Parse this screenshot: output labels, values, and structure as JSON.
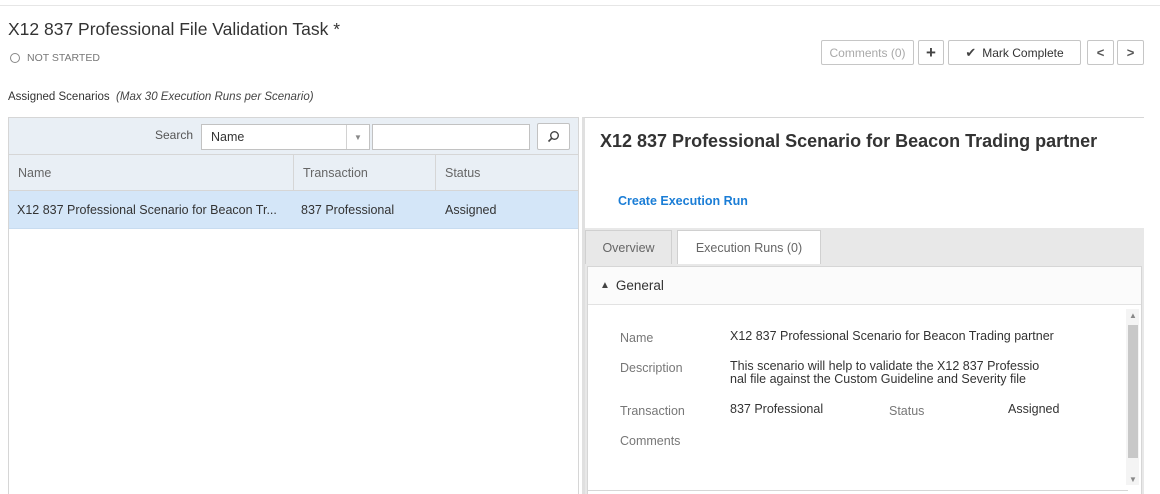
{
  "task": {
    "title": "X12 837 Professional File Validation Task *",
    "status": "NOT STARTED"
  },
  "toolbar": {
    "comments_label": "Comments (0)",
    "add_label": "+",
    "complete_label": "Mark Complete",
    "prev_label": "<",
    "next_label": ">"
  },
  "scenarios_label": {
    "text": "Assigned Scenarios",
    "note": "(Max 30 Execution Runs per Scenario)"
  },
  "search": {
    "label": "Search",
    "field_value": "Name",
    "input_value": ""
  },
  "table": {
    "columns": [
      "Name",
      "Transaction",
      "Status"
    ],
    "rows": [
      {
        "name": "X12 837 Professional Scenario for Beacon Tr...",
        "transaction": "837 Professional",
        "status": "Assigned"
      }
    ]
  },
  "detail": {
    "title": "X12 837 Professional Scenario for Beacon Trading partner",
    "create_link": "Create Execution Run",
    "tabs": [
      "Overview",
      "Execution Runs (0)"
    ],
    "active_tab": "Overview",
    "section_title": "General",
    "fields": {
      "name_label": "Name",
      "name_value": "X12 837 Professional Scenario for Beacon Trading partner",
      "description_label": "Description",
      "description_line1": "This scenario will help to validate the X12 837 Professio",
      "description_line2": "nal file against the Custom Guideline and Severity file",
      "transaction_label": "Transaction",
      "transaction_value": "837 Professional",
      "status_label": "Status",
      "status_value": "Assigned",
      "comments_label": "Comments"
    }
  },
  "colors": {
    "accent_link": "#1a7dd6",
    "selected_row": "#d4e6f8",
    "header_bg": "#e9eff5"
  },
  "icons": [
    "status-ring-icon",
    "plus-icon",
    "check-icon",
    "chevron-left-icon",
    "chevron-right-icon",
    "caret-down-icon",
    "search-icon",
    "collapse-icon"
  ]
}
